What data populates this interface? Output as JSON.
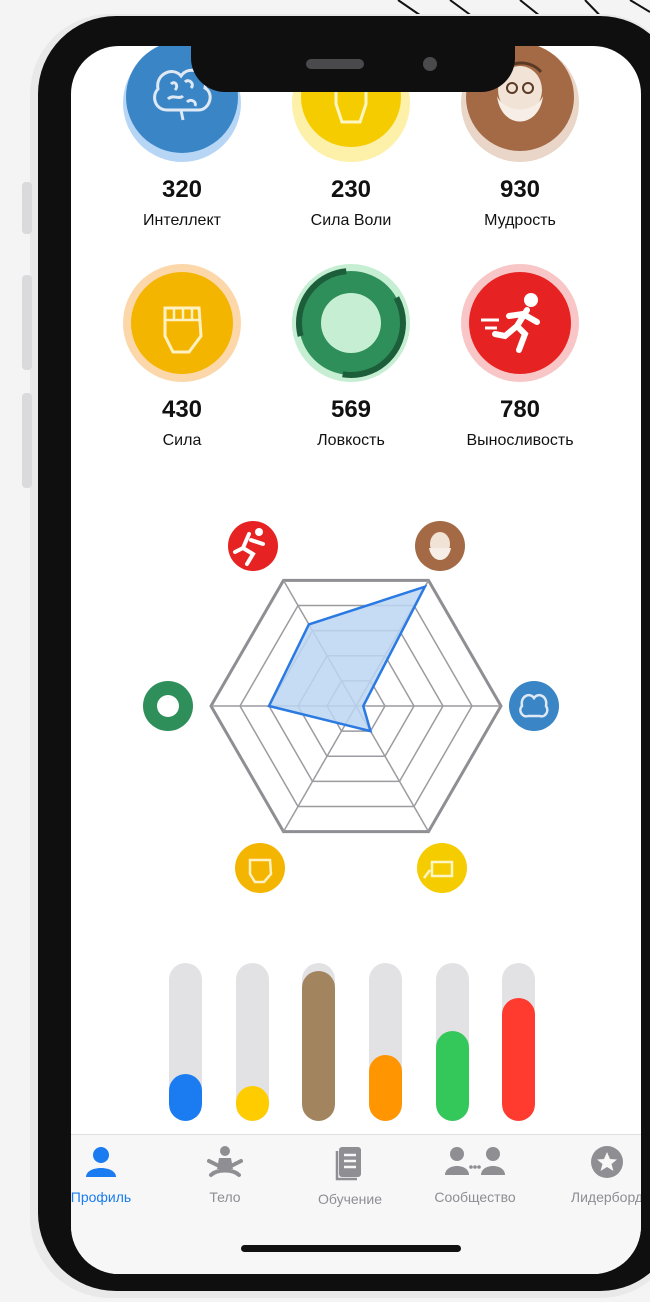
{
  "stats": [
    {
      "value": "320",
      "name": "Интеллект",
      "color": "#3a85c6",
      "icon": "brain-icon"
    },
    {
      "value": "230",
      "name": "Сила Воли",
      "color": "#f5cc00",
      "icon": "raised-fist-icon"
    },
    {
      "value": "930",
      "name": "Мудрость",
      "color": "#a36a45",
      "icon": "wise-man-icon"
    },
    {
      "value": "430",
      "name": "Сила",
      "color": "#f3b500",
      "icon": "fist-icon"
    },
    {
      "value": "569",
      "name": "Ловкость",
      "color": "#2f8f5b",
      "icon": "ring-icon"
    },
    {
      "value": "780",
      "name": "Выносливость",
      "color": "#e62222",
      "icon": "runner-icon"
    }
  ],
  "radar": {
    "axes": [
      "Мудрость",
      "Интеллект",
      "Сила Воли",
      "Сила",
      "Ловкость",
      "Выносливость"
    ],
    "values": [
      0.95,
      0.05,
      0.2,
      0.15,
      0.6,
      0.65
    ],
    "fill": "#bcd6f2",
    "stroke": "#2a7ae2"
  },
  "bars": [
    {
      "fraction": 0.3,
      "color": "#1a7cf0"
    },
    {
      "fraction": 0.22,
      "color": "#ffcc00"
    },
    {
      "fraction": 0.95,
      "color": "#a2845e"
    },
    {
      "fraction": 0.42,
      "color": "#ff9500"
    },
    {
      "fraction": 0.57,
      "color": "#34c759"
    },
    {
      "fraction": 0.78,
      "color": "#ff3b30"
    }
  ],
  "tabs": [
    {
      "label": "Профиль",
      "icon": "person-icon",
      "active": true
    },
    {
      "label": "Тело",
      "icon": "meditation-icon",
      "active": false
    },
    {
      "label": "Обучение",
      "icon": "book-icon",
      "active": false
    },
    {
      "label": "Сообщество",
      "icon": "community-icon",
      "active": false
    },
    {
      "label": "Лидерборд",
      "icon": "star-icon",
      "active": false
    }
  ]
}
